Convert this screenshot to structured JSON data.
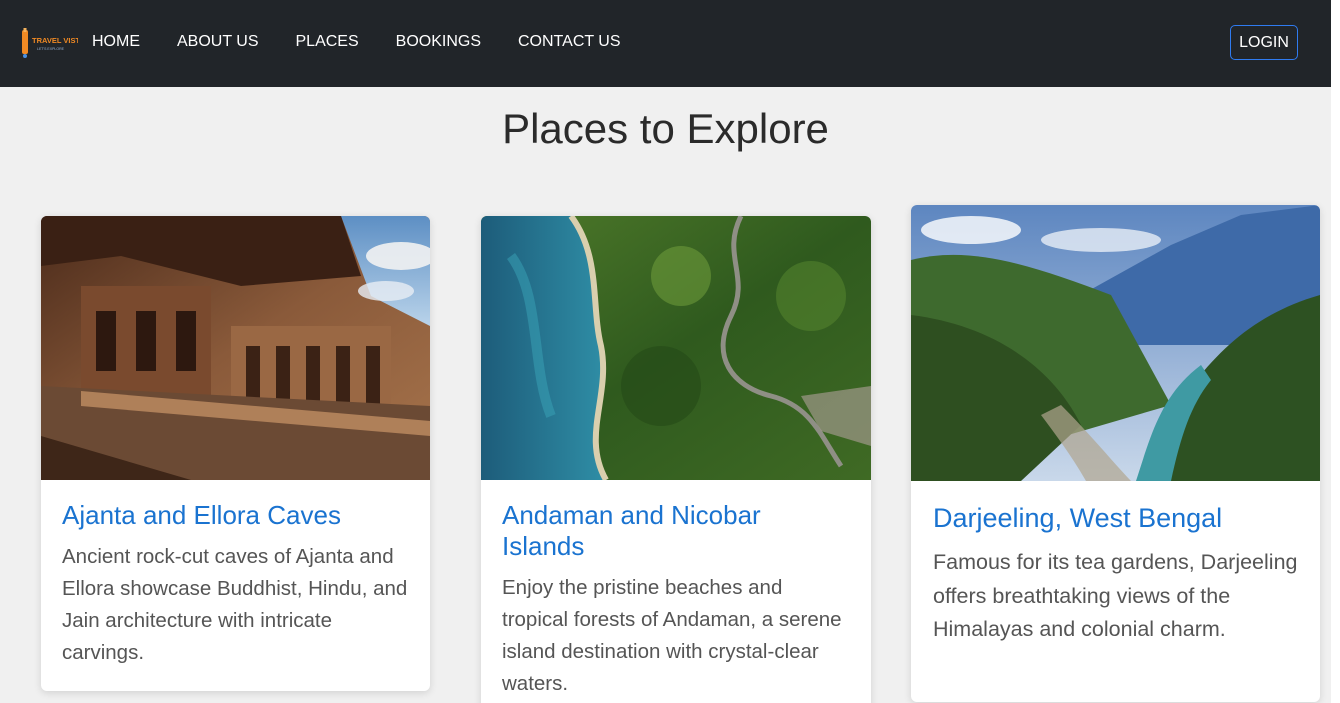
{
  "nav": {
    "logo_text": "TRAVEL VISTA",
    "logo_tagline": "LET'S EXPLORE",
    "links": [
      "HOME",
      "ABOUT US",
      "PLACES",
      "BOOKINGS",
      "CONTACT US"
    ],
    "login_label": "LOGIN"
  },
  "page": {
    "title": "Places to Explore"
  },
  "places": [
    {
      "title": "Ajanta and Ellora Caves",
      "description": "Ancient rock-cut caves of Ajanta and Ellora showcase Buddhist, Hindu, and Jain architecture with intricate carvings."
    },
    {
      "title": "Andaman and Nicobar Islands",
      "description": "Enjoy the pristine beaches and tropical forests of Andaman, a serene island destination with crystal-clear waters."
    },
    {
      "title": "Darjeeling, West Bengal",
      "description": "Famous for its tea gardens, Darjeeling offers breathtaking views of the Himalayas and colonial charm."
    }
  ],
  "colors": {
    "navbar": "#212529",
    "page_bg": "#f0f0f0",
    "card_title": "#1a73d0",
    "login_border": "#2f7bf0"
  }
}
